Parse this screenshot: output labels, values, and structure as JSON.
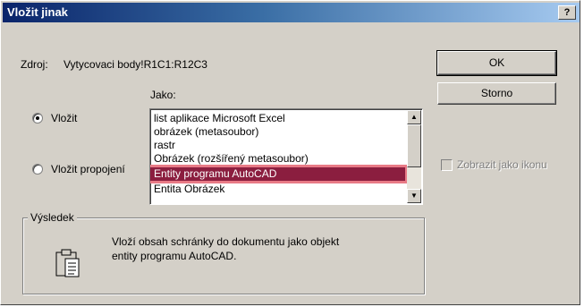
{
  "window": {
    "title": "Vložit jinak",
    "help_label": "?"
  },
  "source": {
    "label": "Zdroj:",
    "value": "Vytycovaci body!R1C1:R12C3"
  },
  "as_label": "Jako:",
  "options": {
    "paste_label": "Vložit",
    "paste_link_label": "Vložit propojení"
  },
  "list": {
    "items": [
      "list aplikace Microsoft Excel",
      "obrázek (metasoubor)",
      "rastr",
      "Obrázek (rozšířený metasoubor)",
      "Entity programu AutoCAD",
      "Entita Obrázek"
    ],
    "selected_index": 4
  },
  "buttons": {
    "ok_label": "OK",
    "cancel_label": "Storno"
  },
  "display_as_icon_label": "Zobrazit jako ikonu",
  "result": {
    "title": "Výsledek",
    "line1": "Vloží obsah schránky do dokumentu jako objekt",
    "line2": "entity programu AutoCAD."
  },
  "colors": {
    "title_start": "#0a246a",
    "selection": "#8b1e3f",
    "highlight": "#e87a86",
    "face": "#d4d0c8"
  },
  "icons": {
    "result_icon": "clipboard-icon"
  }
}
